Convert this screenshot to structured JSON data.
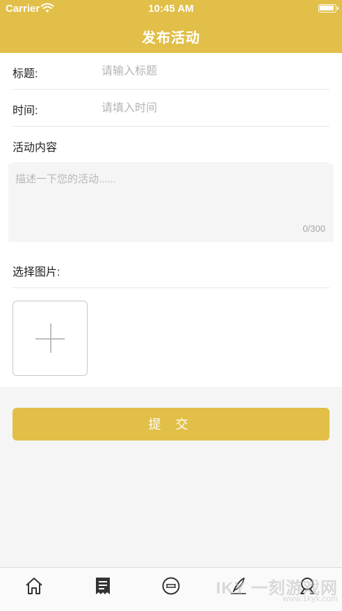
{
  "status": {
    "carrier": "Carrier",
    "time": "10:45 AM"
  },
  "nav": {
    "title": "发布活动"
  },
  "form": {
    "title_label": "标题:",
    "title_placeholder": "请输入标题",
    "time_label": "时间:",
    "time_placeholder": "请填入时间",
    "content_label": "活动内容",
    "content_placeholder": "描述一下您的活动......",
    "content_counter": "0/300",
    "image_label": "选择图片:"
  },
  "submit_label": "提 交",
  "tabs": [
    {
      "icon": "home-icon"
    },
    {
      "icon": "list-icon"
    },
    {
      "icon": "chat-icon"
    },
    {
      "icon": "write-icon"
    },
    {
      "icon": "user-icon"
    }
  ],
  "watermark": {
    "main": "IKY 一刻游戏网",
    "sub": "www.1kyx.com"
  },
  "colors": {
    "accent": "#e1bf48",
    "background": "#f5f5f5"
  }
}
